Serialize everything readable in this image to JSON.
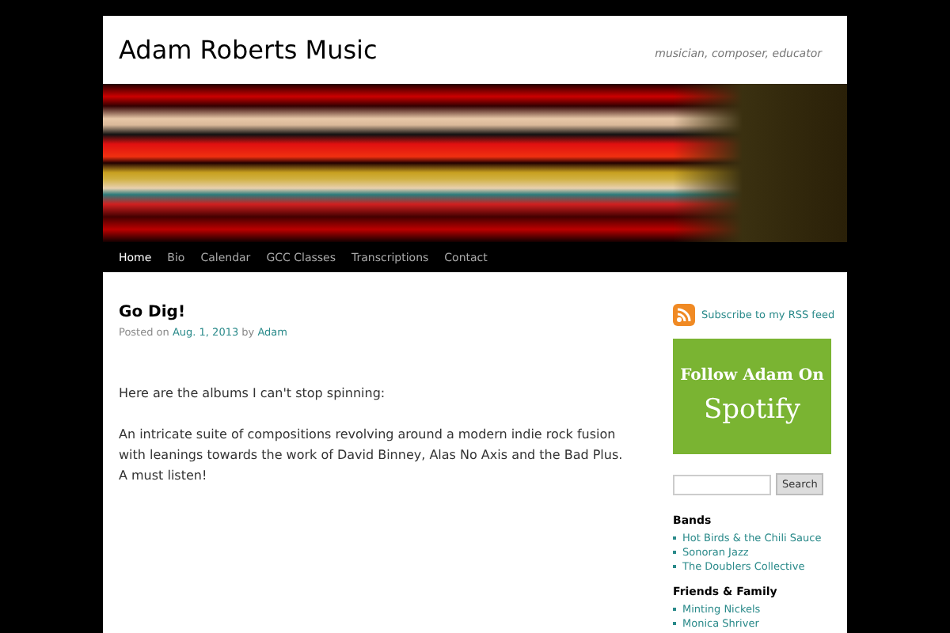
{
  "site": {
    "title": "Adam Roberts Music",
    "tagline": "musician, composer, educator"
  },
  "nav": [
    {
      "label": "Home",
      "selected": true
    },
    {
      "label": "Bio",
      "selected": false
    },
    {
      "label": "Calendar",
      "selected": false
    },
    {
      "label": "GCC Classes",
      "selected": false
    },
    {
      "label": "Transcriptions",
      "selected": false
    },
    {
      "label": "Contact",
      "selected": false
    }
  ],
  "post": {
    "title": "Go Dig!",
    "meta_prefix": "Posted on",
    "date": "Aug. 1, 2013",
    "meta_by": "by",
    "author": "Adam",
    "paragraphs": [
      "Here are the albums I can't stop spinning:",
      "An intricate suite of compositions revolving around a modern indie rock fusion with leanings towards the work of David Binney, Alas No Axis and the Bad Plus. A must listen!"
    ]
  },
  "sidebar": {
    "rss_link": "Subscribe to my RSS feed",
    "spotify_badge": {
      "line_1": "Follow Adam On",
      "line_2": "Spotify"
    },
    "search_button": "Search",
    "sections": [
      {
        "heading": "Bands",
        "links": [
          "Hot Birds & the Chili Sauce",
          "Sonoran Jazz",
          "The Doublers Collective"
        ]
      },
      {
        "heading": "Friends & Family",
        "links": [
          "Minting Nickels",
          "Monica Shriver"
        ]
      }
    ]
  }
}
